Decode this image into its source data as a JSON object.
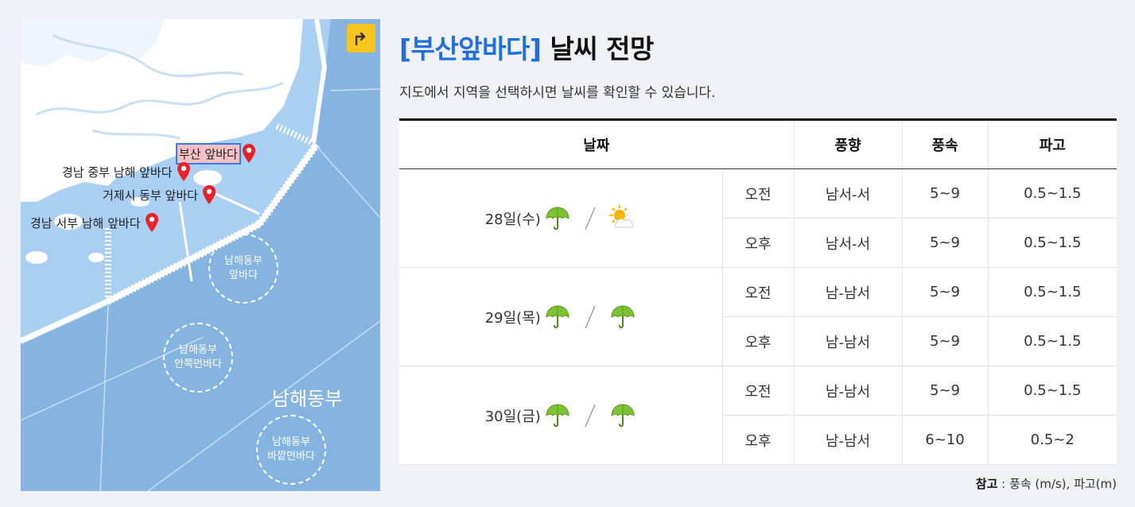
{
  "map": {
    "back_button_icon": "return-arrow-icon",
    "regions": [
      {
        "label": "부산 앞바다",
        "selected": true
      },
      {
        "label": "경남 중부 남해 앞바다",
        "selected": false
      },
      {
        "label": "거제시 동부 앞바다",
        "selected": false
      },
      {
        "label": "경남 서부 남해 앞바다",
        "selected": false
      }
    ],
    "zones": {
      "front": [
        "남해동부",
        "앞바다"
      ],
      "inner": [
        "남해동부",
        "안쪽먼바다"
      ],
      "outer": [
        "남해동부",
        "바깥먼바다"
      ],
      "big": "남해동부"
    },
    "colors": {
      "sea_light": "#a9d0f2",
      "sea_deep": "#85b4e0",
      "land": "#ffffff",
      "pin": "#e8202a",
      "button": "#f7c51e"
    }
  },
  "header": {
    "title_accent": "[부산앞바다]",
    "title_rest": "날씨 전망",
    "subtitle": "지도에서 지역을 선택하시면 날씨를 확인할 수 있습니다."
  },
  "table": {
    "headers": {
      "date": "날짜",
      "wind_dir": "풍향",
      "wind_speed": "풍속",
      "wave": "파고"
    },
    "days": [
      {
        "date": "28일(수)",
        "icons": [
          "umbrella-icon",
          "sun-cloud-icon"
        ],
        "rows": [
          {
            "period": "오전",
            "wind_dir": "남서-서",
            "wind_speed": "5~9",
            "wave": "0.5~1.5"
          },
          {
            "period": "오후",
            "wind_dir": "남서-서",
            "wind_speed": "5~9",
            "wave": "0.5~1.5"
          }
        ]
      },
      {
        "date": "29일(목)",
        "icons": [
          "umbrella-icon",
          "umbrella-icon"
        ],
        "rows": [
          {
            "period": "오전",
            "wind_dir": "남-남서",
            "wind_speed": "5~9",
            "wave": "0.5~1.5"
          },
          {
            "period": "오후",
            "wind_dir": "남-남서",
            "wind_speed": "5~9",
            "wave": "0.5~1.5"
          }
        ]
      },
      {
        "date": "30일(금)",
        "icons": [
          "umbrella-icon",
          "umbrella-icon"
        ],
        "rows": [
          {
            "period": "오전",
            "wind_dir": "남-남서",
            "wind_speed": "5~9",
            "wave": "0.5~1.5"
          },
          {
            "period": "오후",
            "wind_dir": "남-남서",
            "wind_speed": "6~10",
            "wave": "0.5~2"
          }
        ]
      }
    ]
  },
  "note": {
    "label": "참고",
    "text": " : 풍속 (m/s), 파고(m)"
  }
}
